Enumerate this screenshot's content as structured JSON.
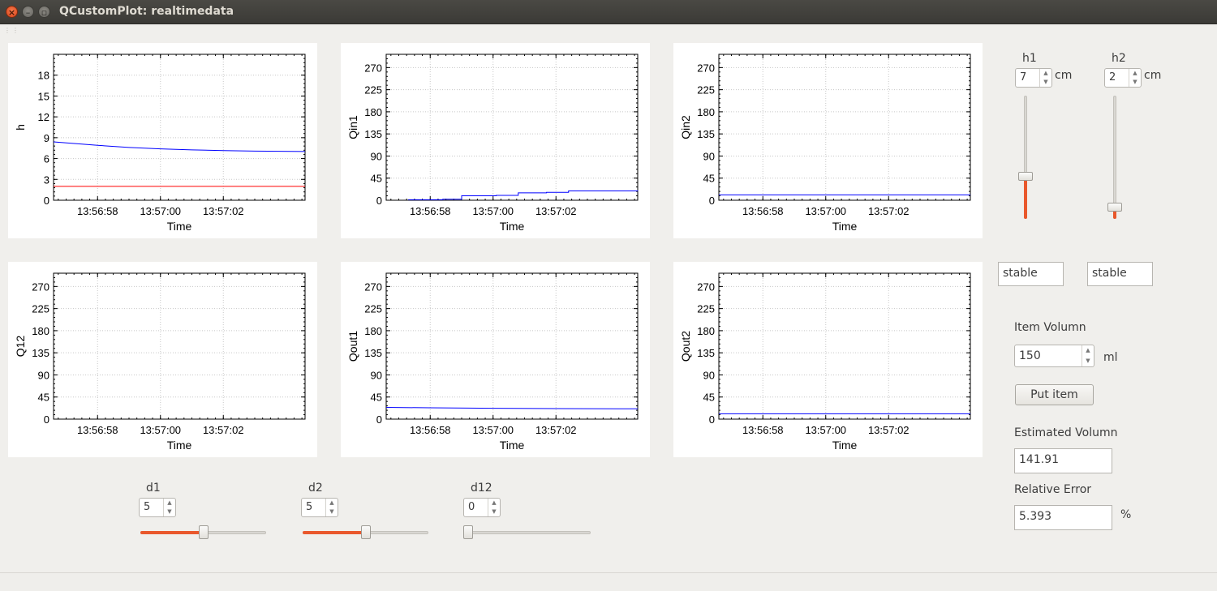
{
  "window": {
    "title": "QCustomPlot: realtimedata"
  },
  "colors": {
    "series_blue": "#0000ff",
    "series_red": "#ff0000",
    "accent_orange": "#e9582c",
    "grid": "#c8c8c8"
  },
  "plots": [
    {
      "ylabel": "h",
      "xlabel": "Time",
      "yticks": [
        "0",
        "3",
        "6",
        "9",
        "12",
        "15",
        "18"
      ],
      "xticks": [
        "13:56:58",
        "13:57:00",
        "13:57:02"
      ]
    },
    {
      "ylabel": "Qin1",
      "xlabel": "Time",
      "yticks": [
        "0",
        "45",
        "90",
        "135",
        "180",
        "225",
        "270"
      ],
      "xticks": [
        "13:56:58",
        "13:57:00",
        "13:57:02"
      ]
    },
    {
      "ylabel": "Qin2",
      "xlabel": "Time",
      "yticks": [
        "0",
        "45",
        "90",
        "135",
        "180",
        "225",
        "270"
      ],
      "xticks": [
        "13:56:58",
        "13:57:00",
        "13:57:02"
      ]
    },
    {
      "ylabel": "Q12",
      "xlabel": "Time",
      "yticks": [
        "0",
        "45",
        "90",
        "135",
        "180",
        "225",
        "270"
      ],
      "xticks": [
        "13:56:58",
        "13:57:00",
        "13:57:02"
      ]
    },
    {
      "ylabel": "Qout1",
      "xlabel": "Time",
      "yticks": [
        "0",
        "45",
        "90",
        "135",
        "180",
        "225",
        "270"
      ],
      "xticks": [
        "13:56:58",
        "13:57:00",
        "13:57:02"
      ]
    },
    {
      "ylabel": "Qout2",
      "xlabel": "Time",
      "yticks": [
        "0",
        "45",
        "90",
        "135",
        "180",
        "225",
        "270"
      ],
      "xticks": [
        "13:56:58",
        "13:57:00",
        "13:57:02"
      ]
    }
  ],
  "chart_data": [
    {
      "type": "line",
      "ylabel": "h",
      "xlabel": "Time",
      "ylim": [
        0,
        21
      ],
      "x": [
        "13:56:56.6",
        "13:56:58",
        "13:56:59",
        "13:57:00",
        "13:57:01",
        "13:57:02",
        "13:57:03",
        "13:57:04.6"
      ],
      "series": [
        {
          "values": [
            8.4,
            7.9,
            7.6,
            7.4,
            7.25,
            7.15,
            7.08,
            7.02
          ]
        },
        {
          "values": [
            2,
            2,
            2,
            2,
            2,
            2,
            2,
            2
          ]
        }
      ]
    },
    {
      "type": "line",
      "ylabel": "Qin1",
      "xlabel": "Time",
      "ylim": [
        0,
        297
      ],
      "x": [
        "13:56:57.3",
        "13:56:58.4",
        "13:56:59",
        "13:57:00.1",
        "13:57:00.8",
        "13:57:01.7",
        "13:57:02.4",
        "13:57:04.6"
      ],
      "series": [
        {
          "values": [
            1,
            2,
            9,
            10,
            15,
            16,
            19,
            20
          ]
        }
      ]
    },
    {
      "type": "line",
      "ylabel": "Qin2",
      "xlabel": "Time",
      "ylim": [
        0,
        297
      ],
      "x": [
        "13:56:56.6",
        "13:57:04.6"
      ],
      "series": [
        {
          "values": [
            11,
            11
          ]
        }
      ]
    },
    {
      "type": "line",
      "ylabel": "Q12",
      "xlabel": "Time",
      "ylim": [
        0,
        297
      ],
      "x": [],
      "series": []
    },
    {
      "type": "line",
      "ylabel": "Qout1",
      "xlabel": "Time",
      "ylim": [
        0,
        297
      ],
      "x": [
        "13:56:56.6",
        "13:56:58",
        "13:57:00",
        "13:57:02",
        "13:57:04.6"
      ],
      "series": [
        {
          "values": [
            24,
            23,
            22,
            21.5,
            21
          ]
        }
      ]
    },
    {
      "type": "line",
      "ylabel": "Qout2",
      "xlabel": "Time",
      "ylim": [
        0,
        297
      ],
      "x": [
        "13:56:56.6",
        "13:57:04.6"
      ],
      "series": [
        {
          "values": [
            11,
            11
          ]
        }
      ]
    }
  ],
  "controls": {
    "h1": {
      "label": "h1",
      "value": "7",
      "unit": "cm",
      "slider_fraction": 0.35
    },
    "h2": {
      "label": "h2",
      "value": "2",
      "unit": "cm",
      "slider_fraction": 0.1
    },
    "status1": "stable",
    "status2": "stable",
    "item_volume": {
      "label": "Item Volumn",
      "value": "150",
      "unit": "ml"
    },
    "put_item": "Put item",
    "estimated": {
      "label": "Estimated Volumn",
      "value": "141.91"
    },
    "relative_error": {
      "label": "Relative Error",
      "value": "5.393",
      "unit": "%"
    },
    "d1": {
      "label": "d1",
      "value": "5",
      "slider_fraction": 0.5
    },
    "d2": {
      "label": "d2",
      "value": "5",
      "slider_fraction": 0.5
    },
    "d12": {
      "label": "d12",
      "value": "0",
      "slider_fraction": 0.0
    }
  }
}
